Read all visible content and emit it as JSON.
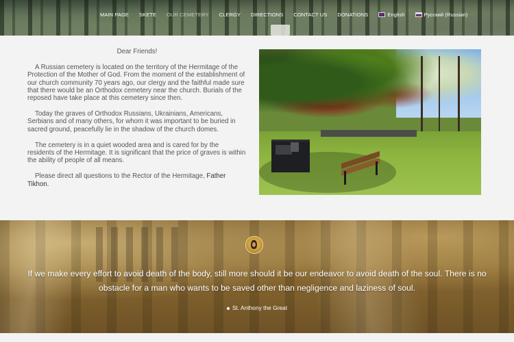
{
  "nav": {
    "items": [
      {
        "label": "MAIN PAGE"
      },
      {
        "label": "SKETE"
      },
      {
        "label": "OUR CEMETERY"
      },
      {
        "label": "CLERGY"
      },
      {
        "label": "DIRECTIONS"
      },
      {
        "label": "CONTACT US"
      },
      {
        "label": "DONATIONS"
      },
      {
        "label": "English",
        "flag": "uk-flag-icon"
      },
      {
        "label": "Русский (Russian)",
        "flag": "ru-flag-icon"
      }
    ],
    "active_item": "OUR CEMETERY",
    "active_color": "#c9cbc3"
  },
  "main": {
    "greeting": "Dear Friends!",
    "paragraphs": [
      "A Russian cemetery is located on the territory of the Hermitage of the Protection of the Mother of God. From the moment of the establishment of our church community 70 years ago, our clergy and the faithful made sure that there would be an Orthodox cemetery near the church. Burials of the reposed have take place at this cemetery since then.",
      "Today the graves of Orthodox Russians, Ukrainians, Americans, Serbians and of many others, for whom it was important to be buried in sacred ground, peacefully lie in the shadow of the church domes.",
      "The cemetery is in a quiet wooded area and is cared for by the residents of the Hermitage. It is significant that the price of graves is within the ability of people of all means."
    ],
    "contact_text": "Please direct all questions to the Rector of the Hermitage,",
    "contact_link": "Father Tikhon."
  },
  "quote": {
    "text": "If we make every effort to avoid death of the body, still more should it be our endeavor to avoid death of the soul. There is no obstacle for a man who wants to be saved other than negligence and laziness of soul.",
    "author": "St. Anthony the Great"
  }
}
